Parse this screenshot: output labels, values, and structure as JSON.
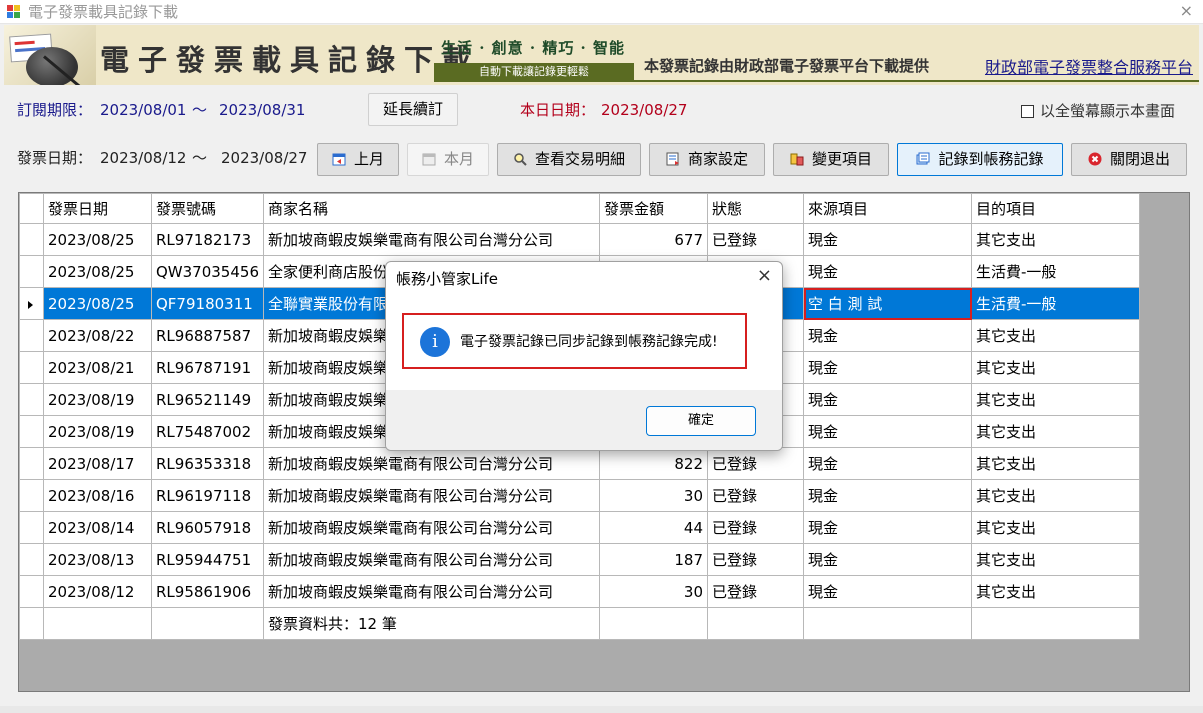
{
  "window": {
    "title": "電子發票載具記錄下載",
    "close_glyph": "×"
  },
  "banner": {
    "title": "電子發票載具記錄下載",
    "slogan": "生活 · 創意 · 精巧 · 智能",
    "sub_slogan": "自動下載讓記錄更輕鬆",
    "info": "本發票記錄由財政部電子發票平台下載提供",
    "platform_link": "財政部電子發票整合服務平台"
  },
  "subscription": {
    "label": "訂閱期限：",
    "start": "2023/08/01",
    "separator": "～",
    "end": "2023/08/31",
    "extend_button": "延長續訂",
    "today_label": "本日日期：",
    "today": "2023/08/27",
    "fullscreen_label": "以全螢幕顯示本畫面",
    "fullscreen_checked": false
  },
  "toolbar": {
    "date_label": "發票日期：",
    "date_start": "2023/08/12",
    "separator": "～",
    "date_end": "2023/08/27",
    "prev_month": "上月",
    "this_month": "本月",
    "view_detail": "查看交易明細",
    "merchant_settings": "商家設定",
    "change_items": "變更項目",
    "record_to_accounts": "記錄到帳務記錄",
    "close_exit": "關閉退出"
  },
  "grid": {
    "columns": [
      "發票日期",
      "發票號碼",
      "商家名稱",
      "發票金額",
      "狀態",
      "來源項目",
      "目的項目"
    ],
    "rows": [
      [
        "2023/08/25",
        "RL97182173",
        "新加坡商蝦皮娛樂電商有限公司台灣分公司",
        "677",
        "已登錄",
        "現金",
        "其它支出"
      ],
      [
        "2023/08/25",
        "QW37035456",
        "全家便利商店股份有限公司",
        "",
        "",
        "現金",
        "生活費-一般"
      ],
      [
        "2023/08/25",
        "QF79180311",
        "全聯實業股份有限公司",
        "",
        "",
        "空 白 測 試",
        "生活費-一般"
      ],
      [
        "2023/08/22",
        "RL96887587",
        "新加坡商蝦皮娛樂電商有限公司台灣分公司",
        "",
        "",
        "現金",
        "其它支出"
      ],
      [
        "2023/08/21",
        "RL96787191",
        "新加坡商蝦皮娛樂電商有限公司台灣分公司",
        "",
        "",
        "現金",
        "其它支出"
      ],
      [
        "2023/08/19",
        "RL96521149",
        "新加坡商蝦皮娛樂電商有限公司台灣分公司",
        "",
        "",
        "現金",
        "其它支出"
      ],
      [
        "2023/08/19",
        "RL75487002",
        "新加坡商蝦皮娛樂電商有限公司台灣分公司",
        "",
        "",
        "現金",
        "其它支出"
      ],
      [
        "2023/08/17",
        "RL96353318",
        "新加坡商蝦皮娛樂電商有限公司台灣分公司",
        "822",
        "已登錄",
        "現金",
        "其它支出"
      ],
      [
        "2023/08/16",
        "RL96197118",
        "新加坡商蝦皮娛樂電商有限公司台灣分公司",
        "30",
        "已登錄",
        "現金",
        "其它支出"
      ],
      [
        "2023/08/14",
        "RL96057918",
        "新加坡商蝦皮娛樂電商有限公司台灣分公司",
        "44",
        "已登錄",
        "現金",
        "其它支出"
      ],
      [
        "2023/08/13",
        "RL95944751",
        "新加坡商蝦皮娛樂電商有限公司台灣分公司",
        "187",
        "已登錄",
        "現金",
        "其它支出"
      ],
      [
        "2023/08/12",
        "RL95861906",
        "新加坡商蝦皮娛樂電商有限公司台灣分公司",
        "30",
        "已登錄",
        "現金",
        "其它支出"
      ]
    ],
    "selected_row": 2,
    "footer": "發票資料共：12 筆"
  },
  "dialog": {
    "title": "帳務小管家Life",
    "close_glyph": "×",
    "icon": "i",
    "message": "電子發票記錄已同步記錄到帳務記錄完成!",
    "ok_label": "確定"
  },
  "colors": {
    "accent": "#0078d7",
    "highlight_border": "#d61f1f",
    "label_blue": "#1a1a8c",
    "label_red": "#b3001b"
  }
}
